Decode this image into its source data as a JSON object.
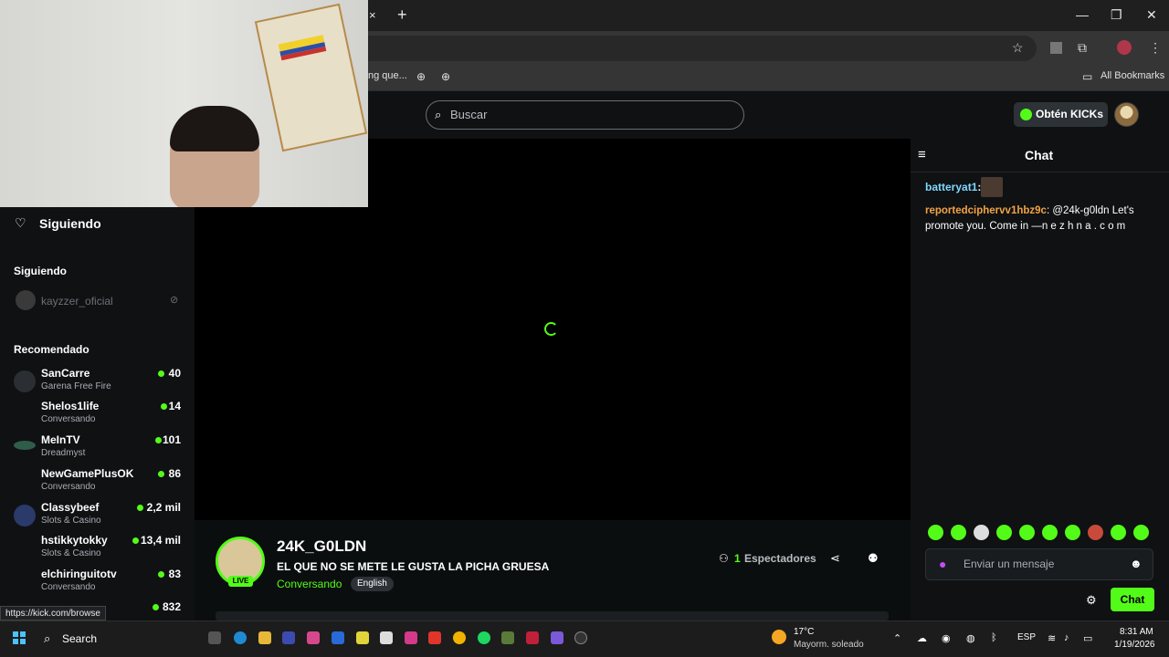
{
  "browser": {
    "tab_close": "×",
    "new_tab": "+",
    "bookmark_cut": "ng que...",
    "all_bookmarks": "All Bookmarks",
    "min": "—",
    "max": "❐",
    "close": "✕"
  },
  "header": {
    "search_placeholder": "Buscar",
    "kicks_label": "Obtén KICKs"
  },
  "sidebar": {
    "following_title": "Siguiendo",
    "following_section": "Siguiendo",
    "offline_channel": "kayzzer_oficial",
    "recommended_section": "Recomendado",
    "recommended": [
      {
        "name": "SanCarre",
        "category": "Garena Free Fire",
        "viewers": "40"
      },
      {
        "name": "Shelos1life",
        "category": "Conversando",
        "viewers": "14"
      },
      {
        "name": "MeInTV",
        "category": "Dreadmyst",
        "viewers": "101"
      },
      {
        "name": "NewGamePlusOK",
        "category": "Conversando",
        "viewers": "86"
      },
      {
        "name": "Classybeef",
        "category": "Slots & Casino",
        "viewers": "2,2 mil"
      },
      {
        "name": "hstikkytokky",
        "category": "Slots & Casino",
        "viewers": "13,4 mil"
      },
      {
        "name": "elchiringuitotv",
        "category": "Conversando",
        "viewers": "83"
      },
      {
        "name": "",
        "category": "",
        "viewers": "832"
      }
    ],
    "status_url": "https://kick.com/browse"
  },
  "stream": {
    "channel": "24K_G0LDN",
    "live": "LIVE",
    "title": "EL QUE NO SE METE LE GUSTA LA PICHA GRUESA",
    "category": "Conversando",
    "language": "English",
    "viewer_count": "1",
    "viewer_label": "Espectadores"
  },
  "chat": {
    "title": "Chat",
    "messages": [
      {
        "user": "batteryat1",
        "text": ""
      },
      {
        "user": "reportedciphervv1hbz9c",
        "text": "@24k-g0ldn Let's promote you. Come in —n e z  h n a . c o m"
      }
    ],
    "input_placeholder": "Enviar un mensaje",
    "send_label": "Chat"
  },
  "taskbar": {
    "search_label": "Search",
    "temperature": "17°C",
    "condition": "Mayorm. soleado",
    "language": "ESP",
    "time": "8:31 AM",
    "date": "1/19/2026"
  },
  "colors": {
    "accent": "#53fc18",
    "chat_user1": "#7fd8ff",
    "chat_user2": "#f2a343"
  }
}
